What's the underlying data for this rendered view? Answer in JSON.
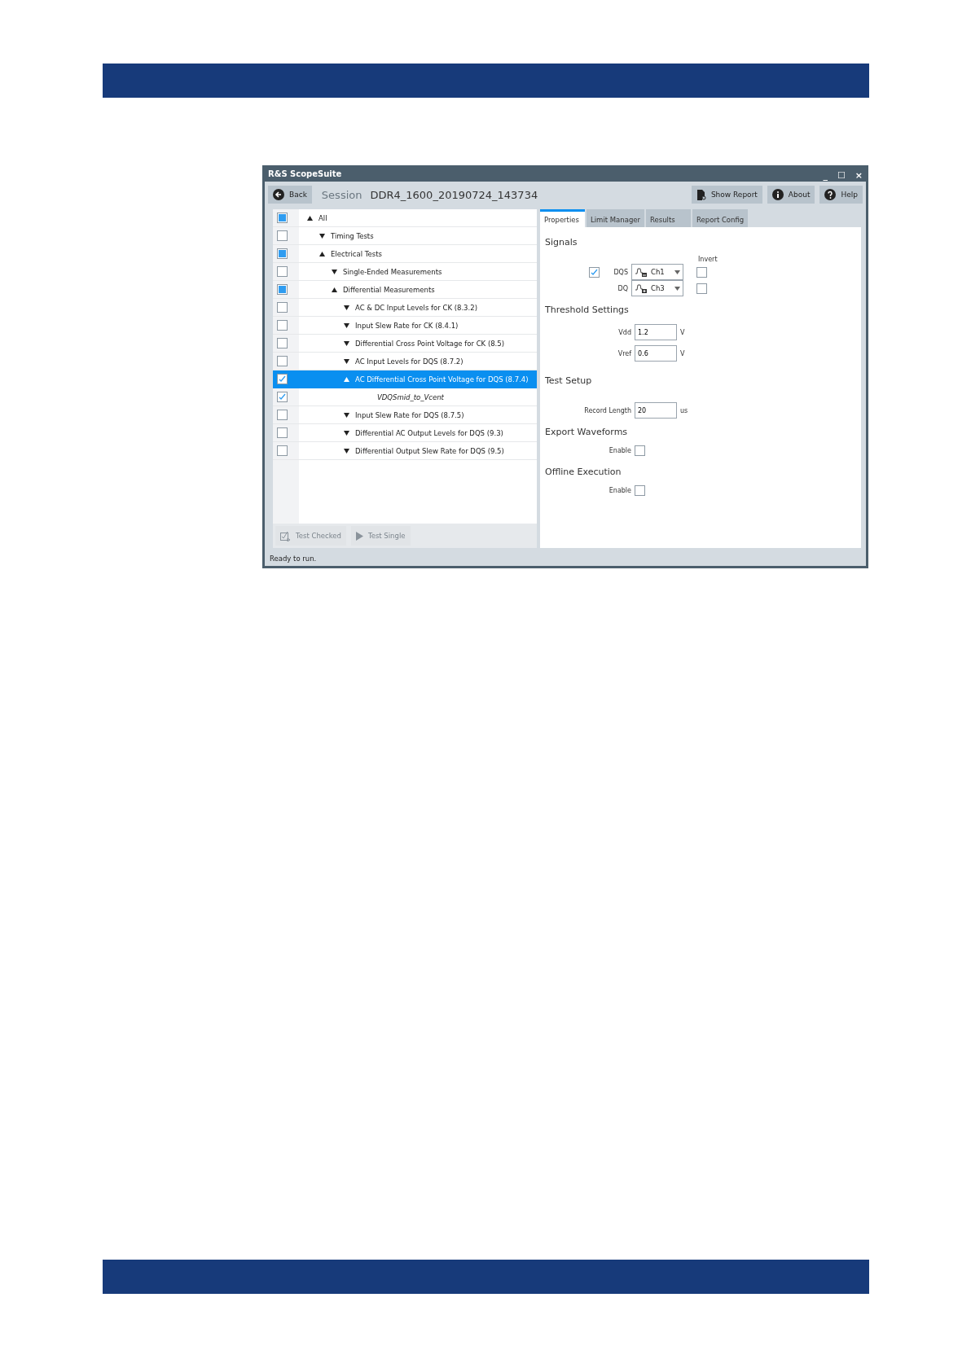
{
  "window": {
    "title": "R&S ScopeSuite",
    "controls": [
      "_",
      "☐",
      "×"
    ]
  },
  "toolbar": {
    "back": "Back",
    "session_label": "Session",
    "session_name": "DDR4_1600_20190724_143734",
    "buttons": [
      {
        "kind": "report",
        "label": "Show Report"
      },
      {
        "kind": "info",
        "label": "About"
      },
      {
        "kind": "help",
        "label": "Help"
      }
    ]
  },
  "tree": [
    {
      "label": "All",
      "kind": "group",
      "checked": false,
      "partial": true,
      "expanded": true,
      "selected": false,
      "children": [
        {
          "label": "Timing Tests",
          "kind": "group",
          "checked": false,
          "partial": false,
          "expanded": false,
          "selected": false
        },
        {
          "label": "Electrical Tests",
          "kind": "group",
          "checked": false,
          "partial": true,
          "expanded": true,
          "selected": false,
          "children": [
            {
              "label": "Single-Ended Measurements",
              "kind": "group",
              "checked": false,
              "partial": false,
              "expanded": false,
              "selected": false
            },
            {
              "label": "Differential Measurements",
              "kind": "group",
              "checked": false,
              "partial": true,
              "expanded": true,
              "selected": false,
              "children": [
                {
                  "label": "AC & DC Input Levels for CK (8.3.2)",
                  "kind": "group",
                  "checked": false,
                  "partial": false,
                  "expanded": false,
                  "selected": false
                },
                {
                  "label": "Input Slew Rate for CK (8.4.1)",
                  "kind": "group",
                  "checked": false,
                  "partial": false,
                  "expanded": false,
                  "selected": false
                },
                {
                  "label": "Differential Cross Point Voltage for CK (8.5)",
                  "kind": "group",
                  "checked": false,
                  "partial": false,
                  "expanded": false,
                  "selected": false
                },
                {
                  "label": "AC Input Levels for DQS (8.7.2)",
                  "kind": "group",
                  "checked": false,
                  "partial": false,
                  "expanded": false,
                  "selected": false
                },
                {
                  "label": "AC Differential Cross Point Voltage for DQS (8.7.4)",
                  "kind": "group",
                  "checked": true,
                  "expanded": true,
                  "selected": true,
                  "children": [
                    {
                      "label": "VDQSmid_to_Vcent",
                      "kind": "test",
                      "checked": true,
                      "selected": false
                    }
                  ]
                },
                {
                  "label": "Input Slew Rate for DQS (8.7.5)",
                  "kind": "group",
                  "checked": false,
                  "partial": false,
                  "expanded": false,
                  "selected": false
                },
                {
                  "label": "Differential AC Output Levels for DQS (9.3)",
                  "kind": "group",
                  "checked": false,
                  "partial": false,
                  "expanded": false,
                  "selected": false
                },
                {
                  "label": "Differential Output Slew Rate for DQS (9.5)",
                  "kind": "group",
                  "checked": false,
                  "partial": false,
                  "expanded": false,
                  "selected": false
                }
              ]
            }
          ]
        }
      ]
    }
  ],
  "actions": [
    {
      "kind": "check",
      "label": "Test Checked",
      "disabled": true
    },
    {
      "kind": "play",
      "label": "Test Single",
      "disabled": true
    }
  ],
  "tabs": [
    {
      "label": "Properties",
      "selected": true
    },
    {
      "label": "Limit Manager",
      "selected": false
    },
    {
      "label": "Results",
      "selected": false
    },
    {
      "label": "Report Config",
      "selected": false
    }
  ],
  "signals": {
    "title": "Signals",
    "invert_label": "Invert",
    "rows": [
      {
        "label": "DQS",
        "checked": true,
        "channel": "Ch1",
        "invert": false
      },
      {
        "label": "DQ",
        "channel": "Ch3",
        "invert": false
      }
    ]
  },
  "threshold": {
    "title": "Threshold Settings",
    "fields": [
      {
        "label": "Vdd",
        "value": "1.2",
        "unit": "V"
      },
      {
        "label": "Vref",
        "value": "0.6",
        "unit": "V"
      }
    ]
  },
  "test_setup": {
    "title": "Test Setup",
    "fields": [
      {
        "label": "Record Length",
        "value": "20",
        "unit": "us"
      }
    ]
  },
  "export_waveforms": {
    "title": "Export Waveforms",
    "label": "Enable",
    "checked": false
  },
  "offline_execution": {
    "title": "Offline Execution",
    "label": "Enable",
    "checked": false
  },
  "status_bar": "Ready to run."
}
